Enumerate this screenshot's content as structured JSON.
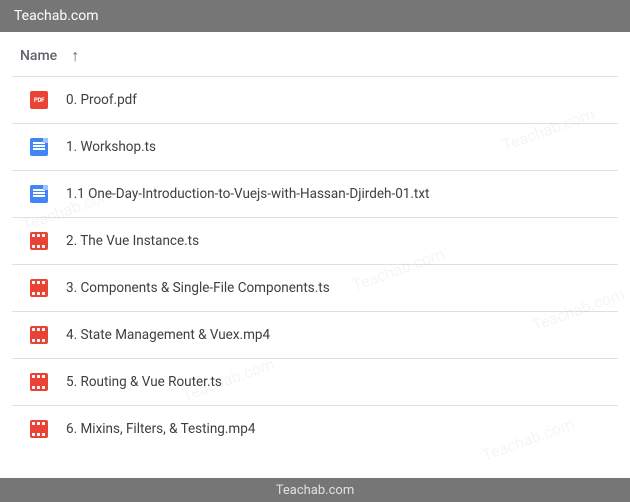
{
  "topbar": {
    "title": "Teachab.com"
  },
  "header": {
    "name_label": "Name"
  },
  "files": [
    {
      "icon": "pdf",
      "name": "0. Proof.pdf"
    },
    {
      "icon": "doc",
      "name": "1. Workshop.ts"
    },
    {
      "icon": "doc",
      "name": "1.1 One-Day-Introduction-to-Vuejs-with-Hassan-Djirdeh-01.txt"
    },
    {
      "icon": "video",
      "name": "2. The Vue Instance.ts"
    },
    {
      "icon": "video",
      "name": "3. Components & Single-File Components.ts"
    },
    {
      "icon": "video",
      "name": "4. State Management & Vuex.mp4"
    },
    {
      "icon": "video",
      "name": "5. Routing & Vue Router.ts"
    },
    {
      "icon": "video",
      "name": "6. Mixins, Filters, & Testing.mp4"
    }
  ],
  "bottombar": {
    "title": "Teachab.com"
  },
  "watermark": "Teachab.com"
}
